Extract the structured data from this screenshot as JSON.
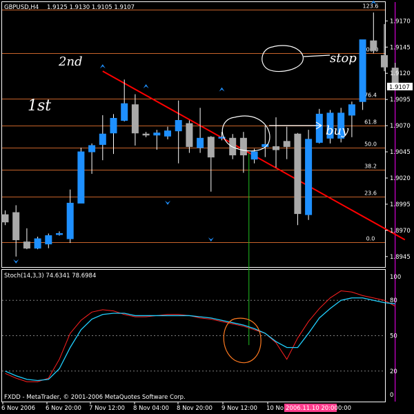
{
  "header": {
    "symbol": "GBPUSD,H4",
    "ohlc": "1.9125 1.9130 1.9105 1.9107"
  },
  "colors": {
    "background": "#000000",
    "frame": "#ffffff",
    "bull": "#1e90ff",
    "bear": "#a9a9a9",
    "doji": "#ffffff",
    "fib": "#c8642a",
    "trendline": "#ff0000",
    "stoch_main": "#ff2020",
    "stoch_signal": "#20d0ff",
    "current_line": "#ff00ff",
    "price_label_bg": "#ffffff",
    "date_label_bg": "#ff3c8c",
    "fractal": "#1e90ff",
    "vertical_marker": "#20c020",
    "annotation": "#ffffff",
    "circle_stoch": "#ff7a20"
  },
  "price_axis": {
    "min": 1.8935,
    "max": 1.9188,
    "ticks": [
      "1.9170",
      "1.9145",
      "1.9120",
      "1.9095",
      "1.9070",
      "1.9045",
      "1.9020",
      "1.8995",
      "1.8970",
      "1.8945"
    ],
    "current_label": "1.9107",
    "current_value": 1.9107
  },
  "fib_levels": [
    {
      "label": "123.6",
      "price": 1.9181
    },
    {
      "label": "100.0",
      "price": 1.9139
    },
    {
      "label": "76.4",
      "price": 1.9096
    },
    {
      "label": "61.8",
      "price": 1.907
    },
    {
      "label": "50.0",
      "price": 1.9049
    },
    {
      "label": "38.2",
      "price": 1.9028
    },
    {
      "label": "23.6",
      "price": 1.9002
    },
    {
      "label": "0.0",
      "price": 1.8959
    }
  ],
  "time_axis": {
    "labels": [
      "6 Nov 2006",
      "6 Nov 20:00",
      "7 Nov 12:00",
      "8 Nov 04:00",
      "8 Nov 20:00",
      "9 Nov 12:00",
      "10 No"
    ],
    "highlight_label": "2006.11.10 20:00",
    "tail_label": "0:00"
  },
  "chart_data": {
    "type": "candlestick",
    "symbol": "GBPUSD,H4",
    "candles": [
      {
        "o": 1.8985,
        "h": 1.8989,
        "l": 1.8975,
        "c": 1.8978
      },
      {
        "o": 1.8987,
        "h": 1.8994,
        "l": 1.8945,
        "c": 1.8961
      },
      {
        "o": 1.8959,
        "h": 1.8972,
        "l": 1.8952,
        "c": 1.8953
      },
      {
        "o": 1.8953,
        "h": 1.8964,
        "l": 1.8952,
        "c": 1.8962
      },
      {
        "o": 1.8957,
        "h": 1.8967,
        "l": 1.8953,
        "c": 1.8965
      },
      {
        "o": 1.8966,
        "h": 1.8969,
        "l": 1.8965,
        "c": 1.8967
      },
      {
        "o": 1.8962,
        "h": 1.9009,
        "l": 1.8958,
        "c": 1.8996
      },
      {
        "o": 1.8996,
        "h": 1.9049,
        "l": 1.8996,
        "c": 1.9045
      },
      {
        "o": 1.9045,
        "h": 1.9053,
        "l": 1.9024,
        "c": 1.9051
      },
      {
        "o": 1.9052,
        "h": 1.908,
        "l": 1.9037,
        "c": 1.9062
      },
      {
        "o": 1.9063,
        "h": 1.9081,
        "l": 1.9043,
        "c": 1.9077
      },
      {
        "o": 1.9075,
        "h": 1.9114,
        "l": 1.9074,
        "c": 1.9091
      },
      {
        "o": 1.909,
        "h": 1.91,
        "l": 1.9051,
        "c": 1.9063
      },
      {
        "o": 1.9062,
        "h": 1.9064,
        "l": 1.9059,
        "c": 1.9061
      },
      {
        "o": 1.9061,
        "h": 1.9066,
        "l": 1.9047,
        "c": 1.9063
      },
      {
        "o": 1.906,
        "h": 1.9069,
        "l": 1.9057,
        "c": 1.9065
      },
      {
        "o": 1.9065,
        "h": 1.9094,
        "l": 1.9034,
        "c": 1.9075
      },
      {
        "o": 1.9072,
        "h": 1.9075,
        "l": 1.9044,
        "c": 1.905
      },
      {
        "o": 1.9049,
        "h": 1.9087,
        "l": 1.9044,
        "c": 1.9058
      },
      {
        "o": 1.9059,
        "h": 1.906,
        "l": 1.9007,
        "c": 1.904
      },
      {
        "o": 1.9058,
        "h": 1.9064,
        "l": 1.9056,
        "c": 1.9059
      },
      {
        "o": 1.9058,
        "h": 1.9062,
        "l": 1.9038,
        "c": 1.9042
      },
      {
        "o": 1.9058,
        "h": 1.9064,
        "l": 1.9025,
        "c": 1.9042
      },
      {
        "o": 1.9038,
        "h": 1.9048,
        "l": 1.9034,
        "c": 1.9045
      },
      {
        "o": 1.905,
        "h": 1.907,
        "l": 1.904,
        "c": 1.9052
      },
      {
        "o": 1.905,
        "h": 1.9078,
        "l": 1.903,
        "c": 1.9047
      },
      {
        "o": 1.9055,
        "h": 1.9069,
        "l": 1.9038,
        "c": 1.905
      },
      {
        "o": 1.9062,
        "h": 1.9063,
        "l": 1.8975,
        "c": 1.8986
      },
      {
        "o": 1.8985,
        "h": 1.9066,
        "l": 1.898,
        "c": 1.9057
      },
      {
        "o": 1.9054,
        "h": 1.9086,
        "l": 1.9053,
        "c": 1.9081
      },
      {
        "o": 1.9058,
        "h": 1.9085,
        "l": 1.9053,
        "c": 1.9082
      },
      {
        "o": 1.9058,
        "h": 1.9087,
        "l": 1.9054,
        "c": 1.9082
      },
      {
        "o": 1.908,
        "h": 1.9093,
        "l": 1.9059,
        "c": 1.909
      },
      {
        "o": 1.9093,
        "h": 1.9151,
        "l": 1.9085,
        "c": 1.9152
      },
      {
        "o": 1.9151,
        "h": 1.9178,
        "l": 1.9139,
        "c": 1.9142
      },
      {
        "o": 1.9137,
        "h": 1.9167,
        "l": 1.9122,
        "c": 1.9126
      },
      {
        "o": 1.9125,
        "h": 1.913,
        "l": 1.9105,
        "c": 1.9107
      }
    ],
    "trendline": [
      {
        "bar": 9,
        "price": 1.9122
      },
      {
        "bar": 36.9,
        "price": 1.8961
      }
    ],
    "fractals": [
      {
        "bar": 1,
        "price": 1.8945,
        "dir": "down"
      },
      {
        "bar": 9,
        "price": 1.9122,
        "dir": "up"
      },
      {
        "bar": 13,
        "price": 1.9103,
        "dir": "up"
      },
      {
        "bar": 15,
        "price": 1.9001,
        "dir": "down"
      },
      {
        "bar": 20,
        "price": 1.91,
        "dir": "up"
      },
      {
        "bar": 19,
        "price": 1.8966,
        "dir": "down"
      },
      {
        "bar": 34,
        "price": 1.9183,
        "dir": "up"
      }
    ],
    "stochastic": {
      "label": "Stoch(14,3,3) 74.6341 78.6984",
      "ylim": [
        0,
        100
      ],
      "levels": [
        20,
        50,
        80
      ],
      "axis_labels": [
        "100",
        "80",
        "50",
        "20",
        "0"
      ],
      "main": [
        18,
        14,
        11,
        11,
        14,
        30,
        52,
        63,
        70,
        72,
        71,
        68,
        66,
        66,
        67,
        68,
        68,
        67,
        65,
        64,
        62,
        60,
        58,
        55,
        52,
        44,
        30,
        48,
        62,
        73,
        82,
        88,
        87,
        84,
        82,
        80,
        75
      ],
      "signal": [
        20,
        16,
        13,
        12,
        13,
        22,
        40,
        55,
        64,
        68,
        69,
        69,
        67,
        67,
        67,
        67,
        67,
        67,
        66,
        65,
        63,
        61,
        59,
        56,
        52,
        45,
        40,
        40,
        52,
        65,
        73,
        80,
        82,
        82,
        80,
        78,
        77
      ]
    }
  },
  "annotations": {
    "second": "2nd",
    "first": "1st",
    "stop": "stop",
    "buy": "buy"
  },
  "watermark": "FXDD - MetaTrader, © 2001-2006 MetaQuotes Software Corp."
}
